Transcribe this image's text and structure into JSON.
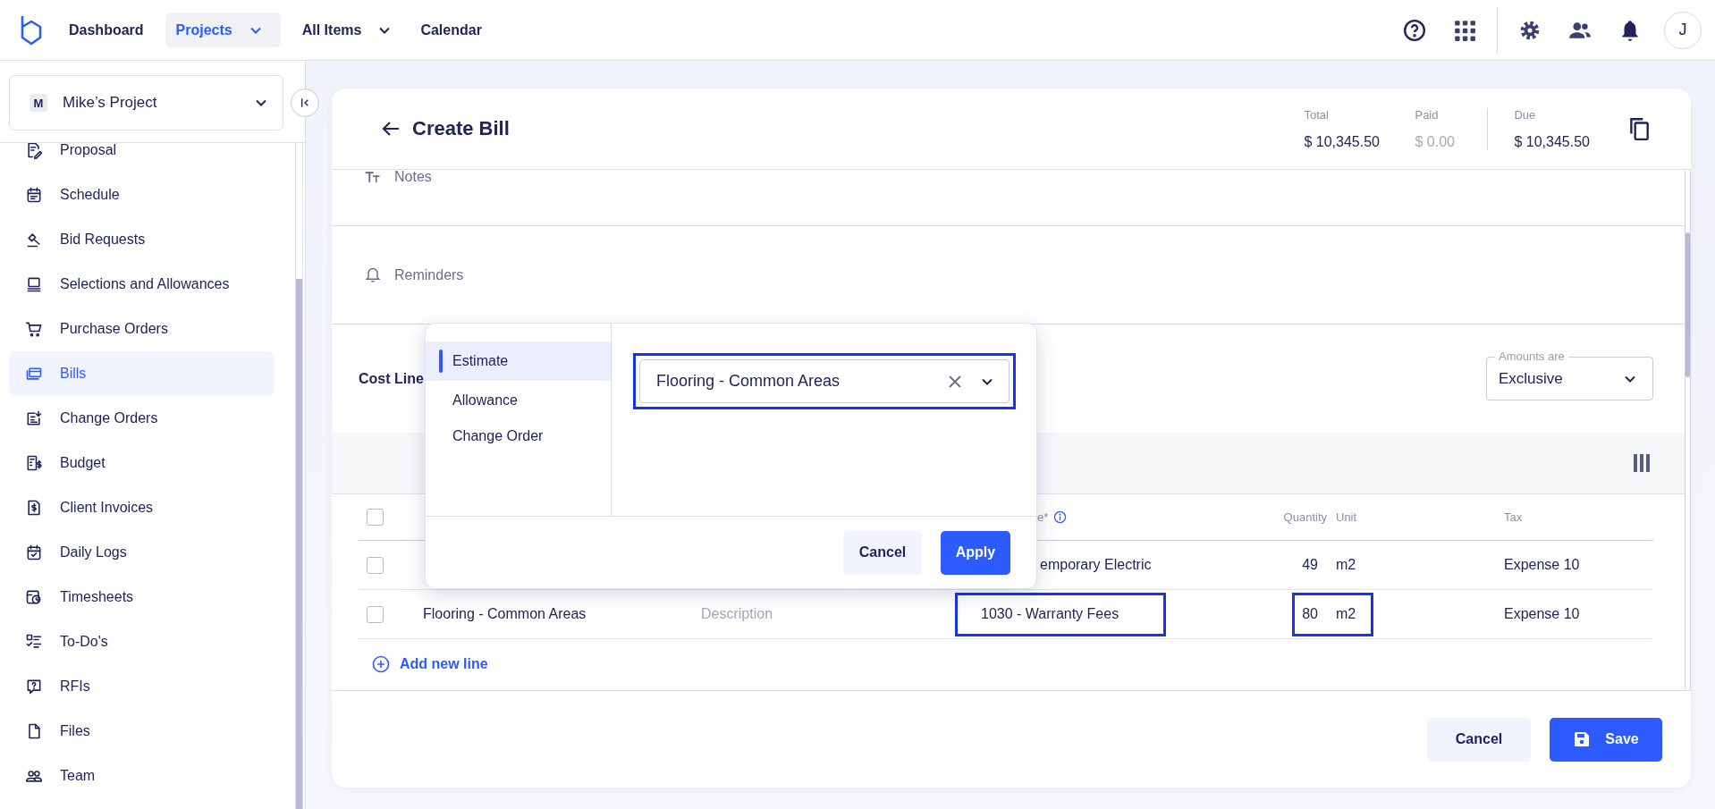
{
  "topbar": {
    "nav": [
      {
        "label": "Dashboard",
        "selected": false,
        "dropdown": false
      },
      {
        "label": "Projects",
        "selected": true,
        "dropdown": true
      },
      {
        "label": "All Items",
        "selected": false,
        "dropdown": true
      },
      {
        "label": "Calendar",
        "selected": false,
        "dropdown": false
      }
    ],
    "avatar": "J"
  },
  "sidebar": {
    "project": {
      "initial": "M",
      "name": "Mike’s Project"
    },
    "items": [
      {
        "label": "Proposal",
        "selected": false
      },
      {
        "label": "Schedule",
        "selected": false
      },
      {
        "label": "Bid Requests",
        "selected": false
      },
      {
        "label": "Selections and Allowances",
        "selected": false
      },
      {
        "label": "Purchase Orders",
        "selected": false
      },
      {
        "label": "Bills",
        "selected": true
      },
      {
        "label": "Change Orders",
        "selected": false
      },
      {
        "label": "Budget",
        "selected": false
      },
      {
        "label": "Client Invoices",
        "selected": false
      },
      {
        "label": "Daily Logs",
        "selected": false
      },
      {
        "label": "Timesheets",
        "selected": false
      },
      {
        "label": "To-Do's",
        "selected": false
      },
      {
        "label": "RFIs",
        "selected": false
      },
      {
        "label": "Files",
        "selected": false
      },
      {
        "label": "Team",
        "selected": false
      }
    ]
  },
  "bill": {
    "title": "Create Bill",
    "totals": [
      {
        "label": "Total",
        "value": "$ 10,345.50",
        "muted": false,
        "separated": false
      },
      {
        "label": "Paid",
        "value": "$ 0.00",
        "muted": true,
        "separated": false
      },
      {
        "label": "Due",
        "value": "$ 10,345.50",
        "muted": false,
        "separated": true
      }
    ],
    "sections": [
      {
        "label": "Notes"
      },
      {
        "label": "Reminders"
      }
    ],
    "cost_lines": {
      "title": "Cost Line",
      "amounts": {
        "label": "Amounts are",
        "value": "Exclusive"
      },
      "header": {
        "checked": false,
        "code": "e*",
        "code_partly_hidden": true,
        "quantity": "Quantity",
        "unit": "Unit",
        "tax": "Tax"
      },
      "rows": [
        {
          "checked": false,
          "code": "emporary Electric",
          "code_partly_hidden": true,
          "code_highlighted": false,
          "quantity": "49",
          "unit": "m2",
          "quantity_highlighted": false,
          "tax": "Expense 10"
        },
        {
          "checked": false,
          "item": "Flooring - Common Areas",
          "description_placeholder": "Description",
          "code": "1030 - Warranty Fees",
          "code_partly_hidden": false,
          "code_highlighted": true,
          "quantity": "80",
          "unit": "m2",
          "quantity_highlighted": true,
          "tax": "Expense 10"
        }
      ],
      "add_line": "Add new line"
    },
    "buttons": [
      {
        "label": "Cancel",
        "kind": "secondary"
      },
      {
        "label": "Save",
        "kind": "save"
      }
    ]
  },
  "popup": {
    "tabs": [
      {
        "label": "Estimate",
        "selected": true
      },
      {
        "label": "Allowance",
        "selected": false
      },
      {
        "label": "Change Order",
        "selected": false
      }
    ],
    "select": {
      "value": "Flooring - Common Areas",
      "highlighted": true
    },
    "buttons": [
      {
        "label": "Cancel",
        "kind": "secondary"
      },
      {
        "label": "Apply",
        "kind": "primary"
      }
    ]
  }
}
